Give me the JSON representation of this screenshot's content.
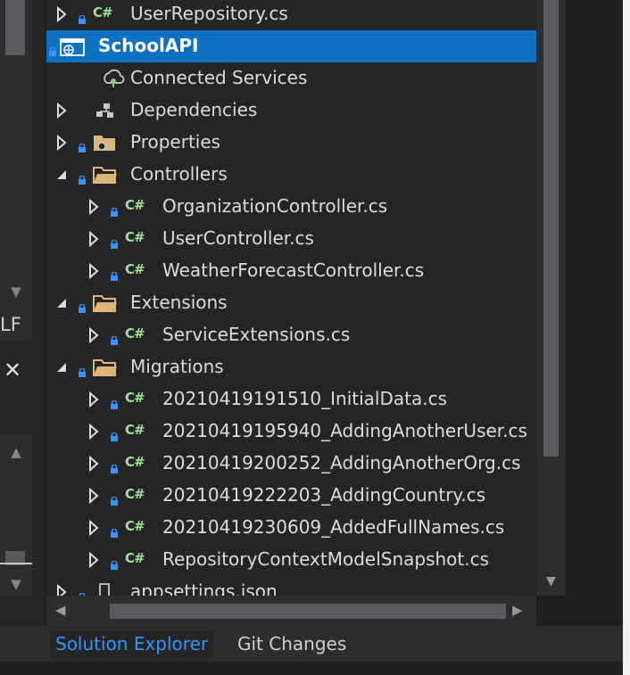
{
  "tree": {
    "items": [
      {
        "label": "UserRepository.cs",
        "kind": "cs"
      },
      {
        "label": "SchoolAPI",
        "kind": "project"
      },
      {
        "label": "Connected Services",
        "kind": "connected"
      },
      {
        "label": "Dependencies",
        "kind": "deps"
      },
      {
        "label": "Properties",
        "kind": "folder"
      },
      {
        "label": "Controllers",
        "kind": "folder"
      },
      {
        "label": "OrganizationController.cs",
        "kind": "cs"
      },
      {
        "label": "UserController.cs",
        "kind": "cs"
      },
      {
        "label": "WeatherForecastController.cs",
        "kind": "cs"
      },
      {
        "label": "Extensions",
        "kind": "folder"
      },
      {
        "label": "ServiceExtensions.cs",
        "kind": "cs"
      },
      {
        "label": "Migrations",
        "kind": "folder"
      },
      {
        "label": "20210419191510_InitialData.cs",
        "kind": "cs"
      },
      {
        "label": "20210419195940_AddingAnotherUser.cs",
        "kind": "cs"
      },
      {
        "label": "20210419200252_AddingAnotherOrg.cs",
        "kind": "cs"
      },
      {
        "label": "20210419222203_AddingCountry.cs",
        "kind": "cs"
      },
      {
        "label": "20210419230609_AddedFullNames.cs",
        "kind": "cs"
      },
      {
        "label": "RepositoryContextModelSnapshot.cs",
        "kind": "cs"
      },
      {
        "label": "appsettings.json",
        "kind": "json"
      }
    ],
    "cs_badge": "C#"
  },
  "left_pane": {
    "label": "LF",
    "close_glyph": "✕"
  },
  "tabs": {
    "solution_explorer": "Solution Explorer",
    "git_changes": "Git Changes"
  },
  "colors": {
    "selection": "#0e70c0",
    "cs_icon": "#9ae29a",
    "folder": "#dcb67a",
    "active_tab_text": "#3794ff"
  }
}
